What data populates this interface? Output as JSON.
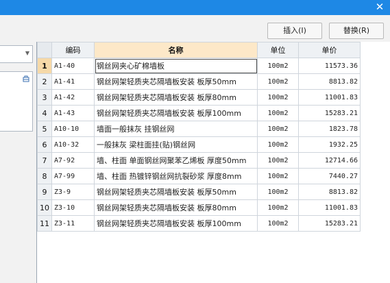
{
  "window": {
    "close_glyph": "✕"
  },
  "toolbar": {
    "insert_label": "插入(I)",
    "replace_label": "替换(R)"
  },
  "table": {
    "headers": {
      "code": "编码",
      "name": "名称",
      "unit": "单位",
      "price": "单价"
    },
    "rows": [
      {
        "num": "1",
        "code": "A1-40",
        "name": "钢丝网夹心矿棉墙板",
        "unit": "100m2",
        "price": "11573.36"
      },
      {
        "num": "2",
        "code": "A1-41",
        "name": "钢丝网架轻质夹芯隔墙板安装 板厚50mm",
        "unit": "100m2",
        "price": "8813.82"
      },
      {
        "num": "3",
        "code": "A1-42",
        "name": "钢丝网架轻质夹芯隔墙板安装 板厚80mm",
        "unit": "100m2",
        "price": "11001.83"
      },
      {
        "num": "4",
        "code": "A1-43",
        "name": "钢丝网架轻质夹芯隔墙板安装 板厚100mm",
        "unit": "100m2",
        "price": "15283.21"
      },
      {
        "num": "5",
        "code": "A10-10",
        "name": "墙面一般抹灰 挂钢丝网",
        "unit": "100m2",
        "price": "1823.78"
      },
      {
        "num": "6",
        "code": "A10-32",
        "name": "一般抹灰 梁柱面挂(贴)钢丝网",
        "unit": "100m2",
        "price": "1932.25"
      },
      {
        "num": "7",
        "code": "A7-92",
        "name": "墙、柱面 单面钢丝网聚苯乙烯板 厚度50mm",
        "unit": "100m2",
        "price": "12714.66"
      },
      {
        "num": "8",
        "code": "A7-99",
        "name": "墙、柱面 热镀锌钢丝网抗裂砂浆 厚度8mm",
        "unit": "100m2",
        "price": "7440.27"
      },
      {
        "num": "9",
        "code": "Z3-9",
        "name": "钢丝网架轻质夹芯隔墙板安装 板厚50mm",
        "unit": "100m2",
        "price": "8813.82"
      },
      {
        "num": "10",
        "code": "Z3-10",
        "name": "钢丝网架轻质夹芯隔墙板安装 板厚80mm",
        "unit": "100m2",
        "price": "11001.83"
      },
      {
        "num": "11",
        "code": "Z3-11",
        "name": "钢丝网架轻质夹芯隔墙板安装 板厚100mm",
        "unit": "100m2",
        "price": "15283.21"
      }
    ]
  },
  "colors": {
    "titlebar": "#1e88e5",
    "name_header": "#fde8c8",
    "active_row_num": "#f6d9a8"
  }
}
